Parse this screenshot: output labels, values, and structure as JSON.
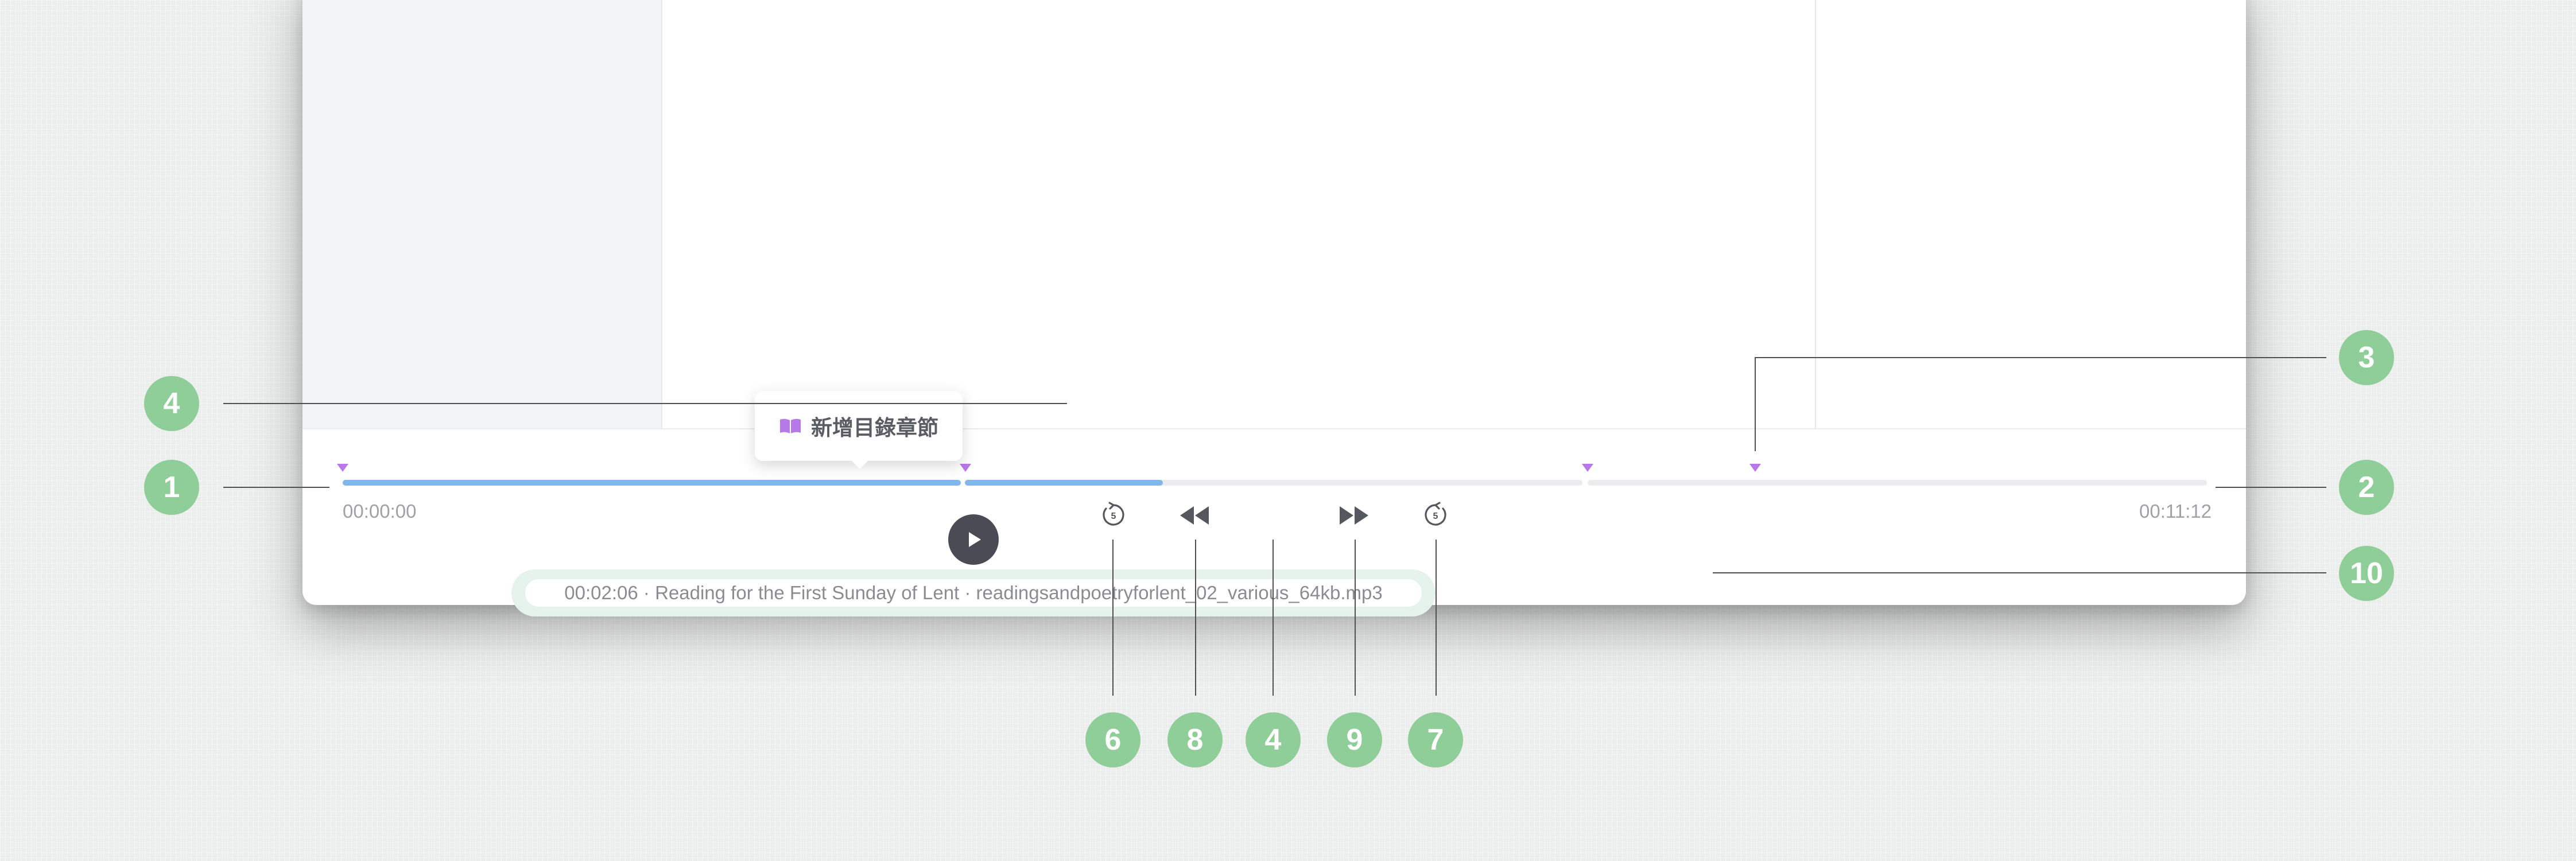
{
  "player": {
    "current_time": "00:00:00",
    "duration": "00:11:12",
    "progress_fraction": 0.441,
    "chapter_markers_seconds": [
      0,
      222,
      423,
      477
    ],
    "track_info": "00:02:06 · Reading for the First Sunday of Lent · readingsandpoetryforlent_02_various_64kb.mp3",
    "add_chapter_label": "新增目錄章節",
    "skip_seconds": "5"
  },
  "callouts": [
    "1",
    "2",
    "3",
    "4",
    "4",
    "6",
    "8",
    "4",
    "9",
    "7",
    "10"
  ],
  "colors": {
    "progress_fill": "#7fb7ea",
    "marker": "#b779e8",
    "callout": "#8fcd99",
    "play_button": "#4a4b55",
    "info_pill": "#e6f3ec"
  },
  "icons": {
    "tooltip": "book-open-icon",
    "replay": "rewind-5s-icon",
    "forward": "forward-5s-icon",
    "prev": "fast-rewind-icon",
    "next": "fast-forward-icon",
    "play": "play-icon"
  }
}
